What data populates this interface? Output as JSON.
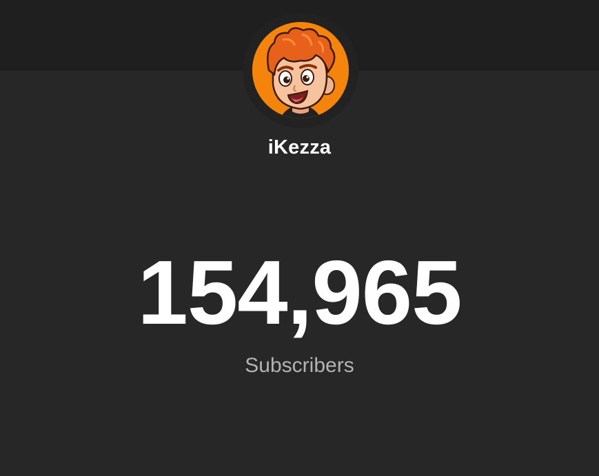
{
  "channel": {
    "name": "iKezza",
    "avatar_icon": "cartoon-boy-avatar",
    "avatar_bg_color": "#f5840c"
  },
  "stats": {
    "subscriber_count": "154,965",
    "subscriber_label": "Subscribers"
  },
  "colors": {
    "page_bg": "#272727",
    "header_bg": "#1f1f1f",
    "count_text": "#ffffff",
    "label_text": "#b3b3b3"
  }
}
